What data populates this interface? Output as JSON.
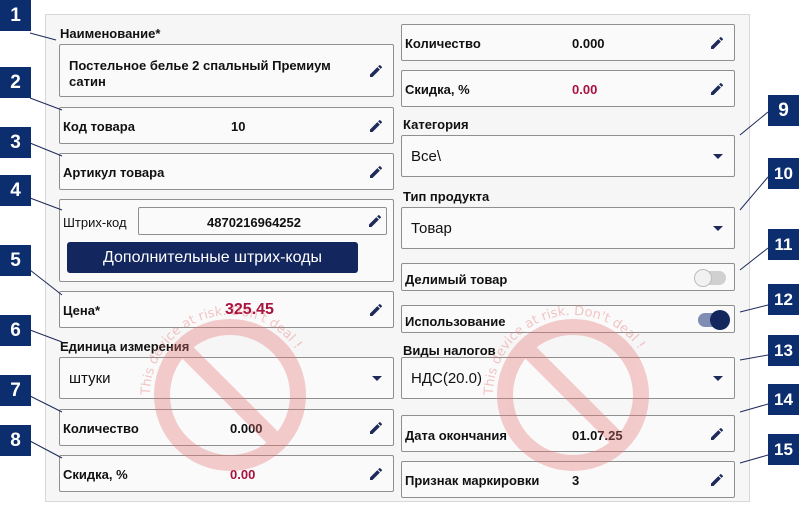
{
  "left": {
    "name_label": "Наименование*",
    "name_value_line1": "Постельное белье  2 спальный  Премиум",
    "name_value_line2": "сатин",
    "code_label": "Код товара",
    "code_value": "10",
    "article_label": "Артикул товара",
    "barcode_label": "Штрих-код",
    "barcode_value": "4870216964252",
    "extra_barcodes_button": "Дополнительные штрих-коды",
    "price_label": "Цена*",
    "price_value": "325.45",
    "unit_label": "Единица измерения",
    "unit_value": "штуки",
    "qty_label": "Количество",
    "qty_value": "0.000",
    "discount_label": "Скидка, %",
    "discount_value": "0.00"
  },
  "right": {
    "qty_label": "Количество",
    "qty_value": "0.000",
    "discount_label": "Скидка, %",
    "discount_value": "0.00",
    "category_label": "Категория",
    "category_value": "Все\\",
    "product_type_label": "Тип продукта",
    "product_type_value": "Товар",
    "divisible_label": "Делимый товар",
    "divisible_on": false,
    "usage_label": "Использование",
    "usage_on": true,
    "taxes_label": "Виды налогов",
    "taxes_value": "НДС(20.0)",
    "end_date_label": "Дата окончания",
    "end_date_value": "01.07.25",
    "marking_label": "Признак маркировки",
    "marking_value": "3"
  },
  "callouts": [
    "1",
    "2",
    "3",
    "4",
    "5",
    "6",
    "7",
    "8",
    "9",
    "10",
    "11",
    "12",
    "13",
    "14",
    "15"
  ],
  "colors": {
    "accent": "#13275e",
    "callout": "#0d2e6e",
    "value_red": "#a8123e",
    "watermark": "#e57373"
  },
  "watermark_text": "This device at risk. Don't deal !"
}
